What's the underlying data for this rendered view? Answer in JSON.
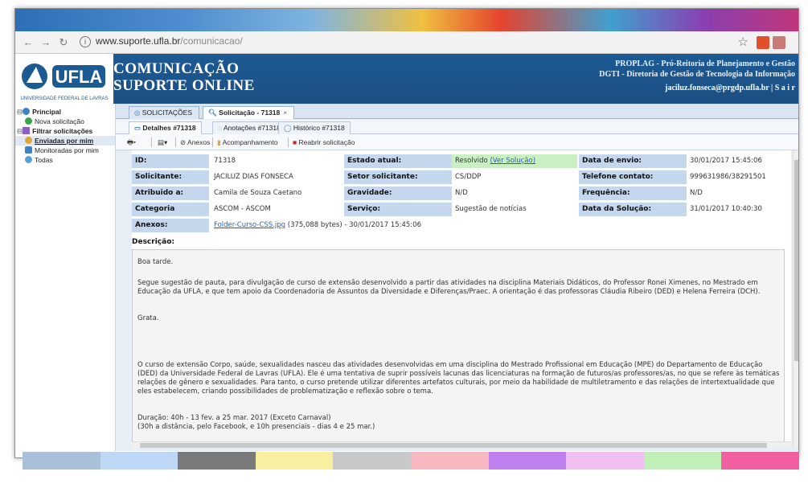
{
  "browser": {
    "tab_ghost": "",
    "url_host": "www.suporte.ufla.br",
    "url_path": "/comunicacao/"
  },
  "header": {
    "logo_text": "UFLA",
    "logo_caption": "UNIVERSIDADE FEDERAL DE LAVRAS",
    "title_line1": "COMUNICAÇÃO",
    "title_line2": "SUPORTE ONLINE",
    "right_line1": "PROPLAG - Pró-Reitoria de Planejamento e Gestão",
    "right_line2": "DGTI - Diretoria de Gestão de Tecnologia da Informação",
    "user": "jaciluz.fonseca@prgdp.ufla.br | S a i r"
  },
  "sidebar": {
    "items": [
      {
        "label": "Principal",
        "icon": "home-icon"
      },
      {
        "label": "Nova solicitação",
        "icon": "add-circle-icon"
      },
      {
        "label": "Filtrar solicitações",
        "icon": "filter-icon"
      },
      {
        "label": "Enviadas por mim",
        "icon": "user-icon"
      },
      {
        "label": "Monitoradas por mim",
        "icon": "monitor-icon"
      },
      {
        "label": "Todas",
        "icon": "globe-icon"
      }
    ]
  },
  "tabs": {
    "solicitacoes": "SOLICITAÇÕES",
    "current": "Solicitação - 71318",
    "close": "×"
  },
  "subtabs": {
    "detalhes": "Detalhes #71318",
    "anotacoes": "Anotações #71318",
    "historico": "Histórico #71318"
  },
  "toolbar": {
    "anexos": "Anexos",
    "acompanhamento": "Acompanhamento",
    "reabrir": "Reabrir solicitação"
  },
  "details": {
    "id_label": "ID:",
    "id_value": "71318",
    "estado_label": "Estado atual:",
    "estado_value": "Resolvido",
    "estado_link": "(Ver Solução)",
    "envio_label": "Data de envio:",
    "envio_value": "30/01/2017 15:45:06",
    "solicitante_label": "Solicitante:",
    "solicitante_value": "JACILUZ DIAS FONSECA",
    "setor_label": "Setor solicitante:",
    "setor_value": "CS/DDP",
    "telefone_label": "Telefone contato:",
    "telefone_value": "999631986/38291501",
    "atribuido_label": "Atribuido a:",
    "atribuido_value": "Camila de Souza Caetano",
    "gravidade_label": "Gravidade:",
    "gravidade_value": "N/D",
    "frequencia_label": "Frequência:",
    "frequencia_value": "N/D",
    "categoria_label": "Categoria",
    "categoria_value": "ASCOM - ASCOM",
    "servico_label": "Serviço:",
    "servico_value": "Sugestão de notícias",
    "solucao_label": "Data da Solução:",
    "solucao_value": "31/01/2017 10:40:30",
    "anexos_label": "Anexos:",
    "anexos_link": "Folder-Curso-CSS.jpg",
    "anexos_meta": " (375,088 bytes) - 30/01/2017 15:45:06",
    "descricao_label": "Descrição:"
  },
  "description": {
    "p1": "Boa tarde.",
    "p2": "Segue sugestão de pauta, para divulgação de curso de extensão desenvolvido a partir das atividades na disciplina Materiais Didáticos, do Professor Ronei Ximenes, no Mestrado em Educação da UFLA, e que tem apoio da Coordenadoria de Assuntos da Diversidade e Diferenças/Praec. A orientação é das professoras Cláudia Ribeiro (DED) e Helena Ferreira (DCH).",
    "p3": "Grata.",
    "p4": "O curso de extensão Corpo, saúde, sexualidades nasceu das atividades desenvolvidas em uma disciplina do Mestrado Profissional em Educação (MPE) do Departamento de Educação (DED) da Universidade Federal de Lavras (UFLA). Ele é uma tentativa de suprir possíveis lacunas das licenciaturas na formação de futuros/as professores/as, no que se refere às temáticas relações de gênero e sexualidades. Para tanto, o curso pretende utilizar diferentes artefatos culturais, por meio da habilidade de multiletramento e das relações de intertextualidade que eles estabelecem, criando possibilidades de problematização e reflexão sobre o tema.",
    "p5": "Duração: 40h - 13 fev. a 25 mar. 2017 (Exceto Carnaval)",
    "p6": "(30h a distância, pelo Facebook, e 10h presenciais - dias 4 e 25 mar.)"
  },
  "colors": {
    "header_blue": "#1c5a94",
    "label_blue": "#c4d7ec",
    "resolved_green": "#c8f0c2",
    "strip": [
      "#a8c0d8",
      "#bcd8f4",
      "#7a7a7a",
      "#f8f0a0",
      "#c8c8c8",
      "#f8b8c0",
      "#c080f0",
      "#f0c0f0",
      "#c0f0b8",
      "#f060a0"
    ]
  }
}
